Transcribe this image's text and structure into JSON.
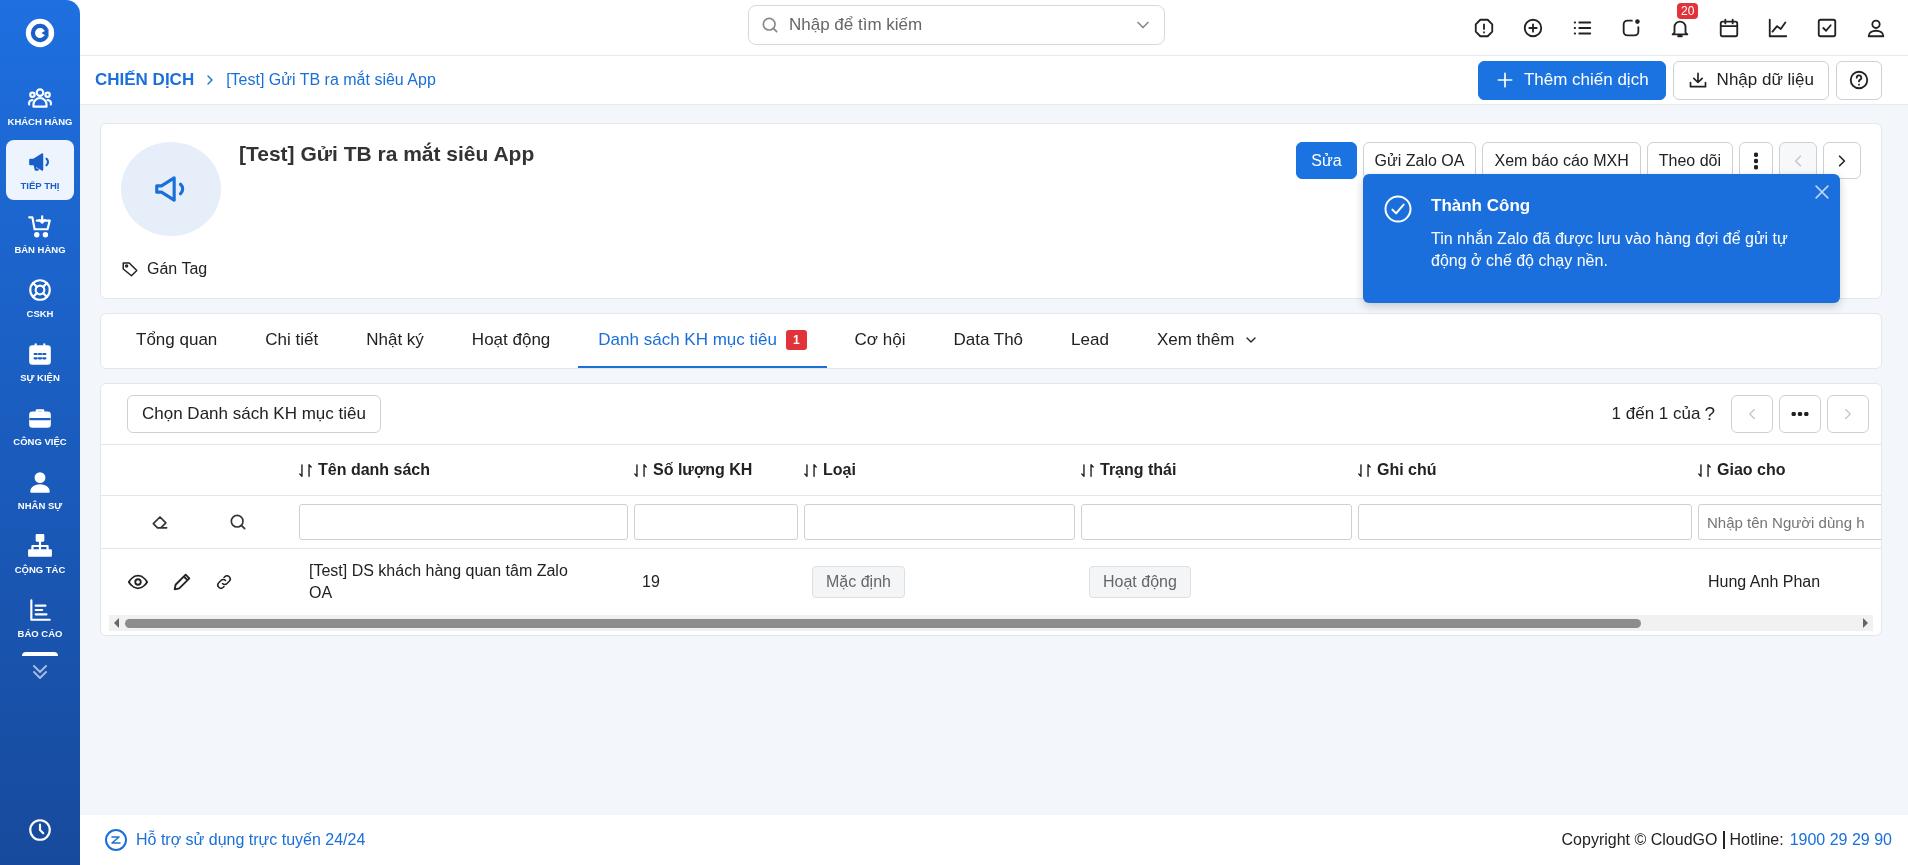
{
  "sidebar": {
    "items": [
      {
        "label": "KHÁCH HÀNG",
        "selected": false
      },
      {
        "label": "TIẾP THỊ",
        "selected": true
      },
      {
        "label": "BÁN HÀNG",
        "selected": false
      },
      {
        "label": "CSKH",
        "selected": false
      },
      {
        "label": "SỰ KIỆN",
        "selected": false
      },
      {
        "label": "CÔNG VIỆC",
        "selected": false
      },
      {
        "label": "NHÂN SỰ",
        "selected": false
      },
      {
        "label": "CỘNG TÁC",
        "selected": false
      },
      {
        "label": "BÁO CÁO",
        "selected": false
      }
    ]
  },
  "topbar": {
    "search": {
      "placeholder": "Nhập để tìm kiếm"
    },
    "notification_count": "20"
  },
  "breadcrumb": {
    "items": [
      "CHIẾN DỊCH",
      "[Test] Gửi TB ra mắt siêu App"
    ]
  },
  "page_actions": [
    {
      "label": "Thêm chiến dịch",
      "kind": "primary"
    },
    {
      "label": "Nhập dữ liệu",
      "kind": "import"
    }
  ],
  "campaign": {
    "title": "[Test] Gửi TB ra mắt siêu App",
    "tag_label": "Gán Tag",
    "actions": [
      {
        "label": "Sửa",
        "kind": "primary"
      },
      {
        "label": "Gửi Zalo OA",
        "kind": "plain"
      },
      {
        "label": "Xem báo cáo MXH",
        "kind": "plain"
      },
      {
        "label": "Theo dõi",
        "kind": "plain"
      }
    ],
    "prev_disabled": true,
    "next_disabled": false
  },
  "toast": {
    "title": "Thành Công",
    "message": "Tin nhắn Zalo đã được lưu vào hàng đợi để gửi tự động ở chế độ chạy nền."
  },
  "tabs": [
    {
      "label": "Tổng quan",
      "selected": false
    },
    {
      "label": "Chi tiết",
      "selected": false
    },
    {
      "label": "Nhật ký",
      "selected": false
    },
    {
      "label": "Hoạt động",
      "selected": false
    },
    {
      "label": "Danh sách KH mục tiêu",
      "selected": true,
      "badge": "1"
    },
    {
      "label": "Cơ hội",
      "selected": false
    },
    {
      "label": "Data Thô",
      "selected": false
    },
    {
      "label": "Lead",
      "selected": false
    },
    {
      "label": "Xem thêm",
      "selected": false,
      "kind": "more"
    }
  ],
  "target_lists": {
    "select_button": "Chọn Danh sách KH mục tiêu",
    "pagination": "1 đến 1 của",
    "total": "?",
    "columns": [
      "Tên danh sách",
      "Số lượng KH",
      "Loại",
      "Trạng thái",
      "Ghi chú",
      "Giao cho"
    ],
    "filters": [
      {
        "kind": "text"
      },
      {
        "kind": "text"
      },
      {
        "kind": "text"
      },
      {
        "kind": "text"
      },
      {
        "kind": "text"
      },
      {
        "kind": "text",
        "placeholder": "Nhập tên Người dùng h"
      }
    ],
    "rows": [
      {
        "name": "[Test] DS khách hàng quan tâm Zalo OA",
        "count": "19",
        "type": "Mặc định",
        "status": "Hoạt động",
        "assignee": "Hung Anh Phan"
      }
    ]
  },
  "footer": {
    "support": "Hỗ trợ sử dụng trực tuyến 24/24",
    "copyright": "Copyright © CloudGO",
    "hotline_label": "Hotline:",
    "hotline": "1900 29 29 90"
  }
}
